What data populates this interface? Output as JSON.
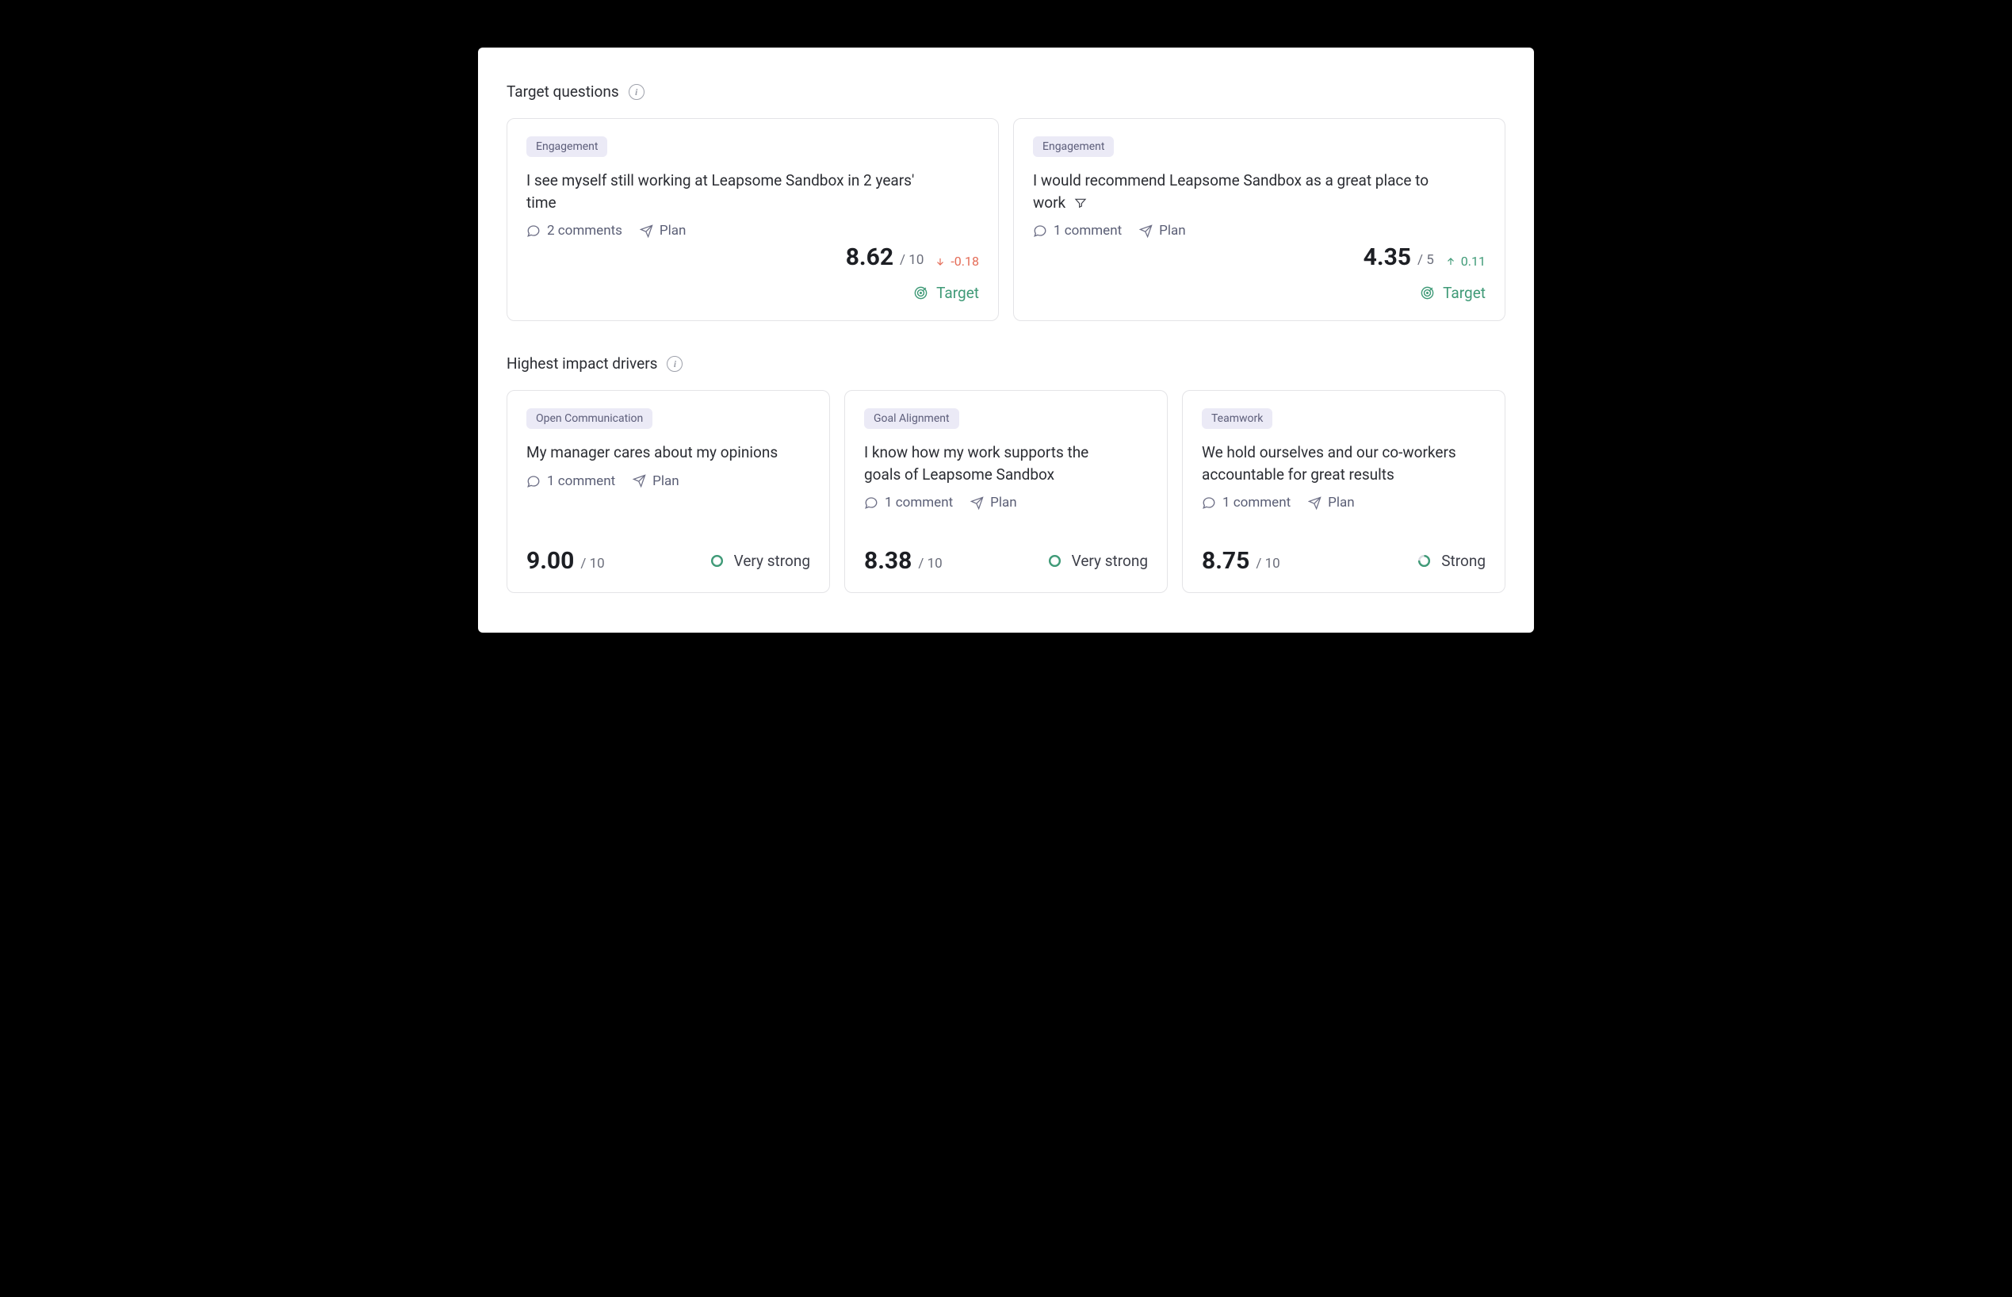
{
  "sections": {
    "target": {
      "title": "Target questions",
      "cards": [
        {
          "chip": "Engagement",
          "question": "I see myself still working at Leapsome Sandbox in 2 years' time",
          "comments": "2 comments",
          "plan": "Plan",
          "score": "8.62",
          "outof": "/ 10",
          "delta": "-0.18",
          "delta_dir": "down",
          "target_label": "Target"
        },
        {
          "chip": "Engagement",
          "question": "I would recommend Leapsome Sandbox as a great place to work",
          "filter_icon": true,
          "comments": "1 comment",
          "plan": "Plan",
          "score": "4.35",
          "outof": "/ 5",
          "delta": "0.11",
          "delta_dir": "up",
          "target_label": "Target"
        }
      ]
    },
    "drivers": {
      "title": "Highest impact drivers",
      "cards": [
        {
          "chip": "Open Communication",
          "question": "My manager cares about my opinions",
          "comments": "1 comment",
          "plan": "Plan",
          "score": "9.00",
          "outof": "/ 10",
          "strength": "Very strong"
        },
        {
          "chip": "Goal Alignment",
          "question": "I know how my work supports the goals of Leapsome Sandbox",
          "comments": "1 comment",
          "plan": "Plan",
          "score": "8.38",
          "outof": "/ 10",
          "strength": "Very strong"
        },
        {
          "chip": "Teamwork",
          "question": "We hold ourselves and our co-workers accountable for great results",
          "comments": "1 comment",
          "plan": "Plan",
          "score": "8.75",
          "outof": "/ 10",
          "strength": "Strong"
        }
      ]
    }
  }
}
